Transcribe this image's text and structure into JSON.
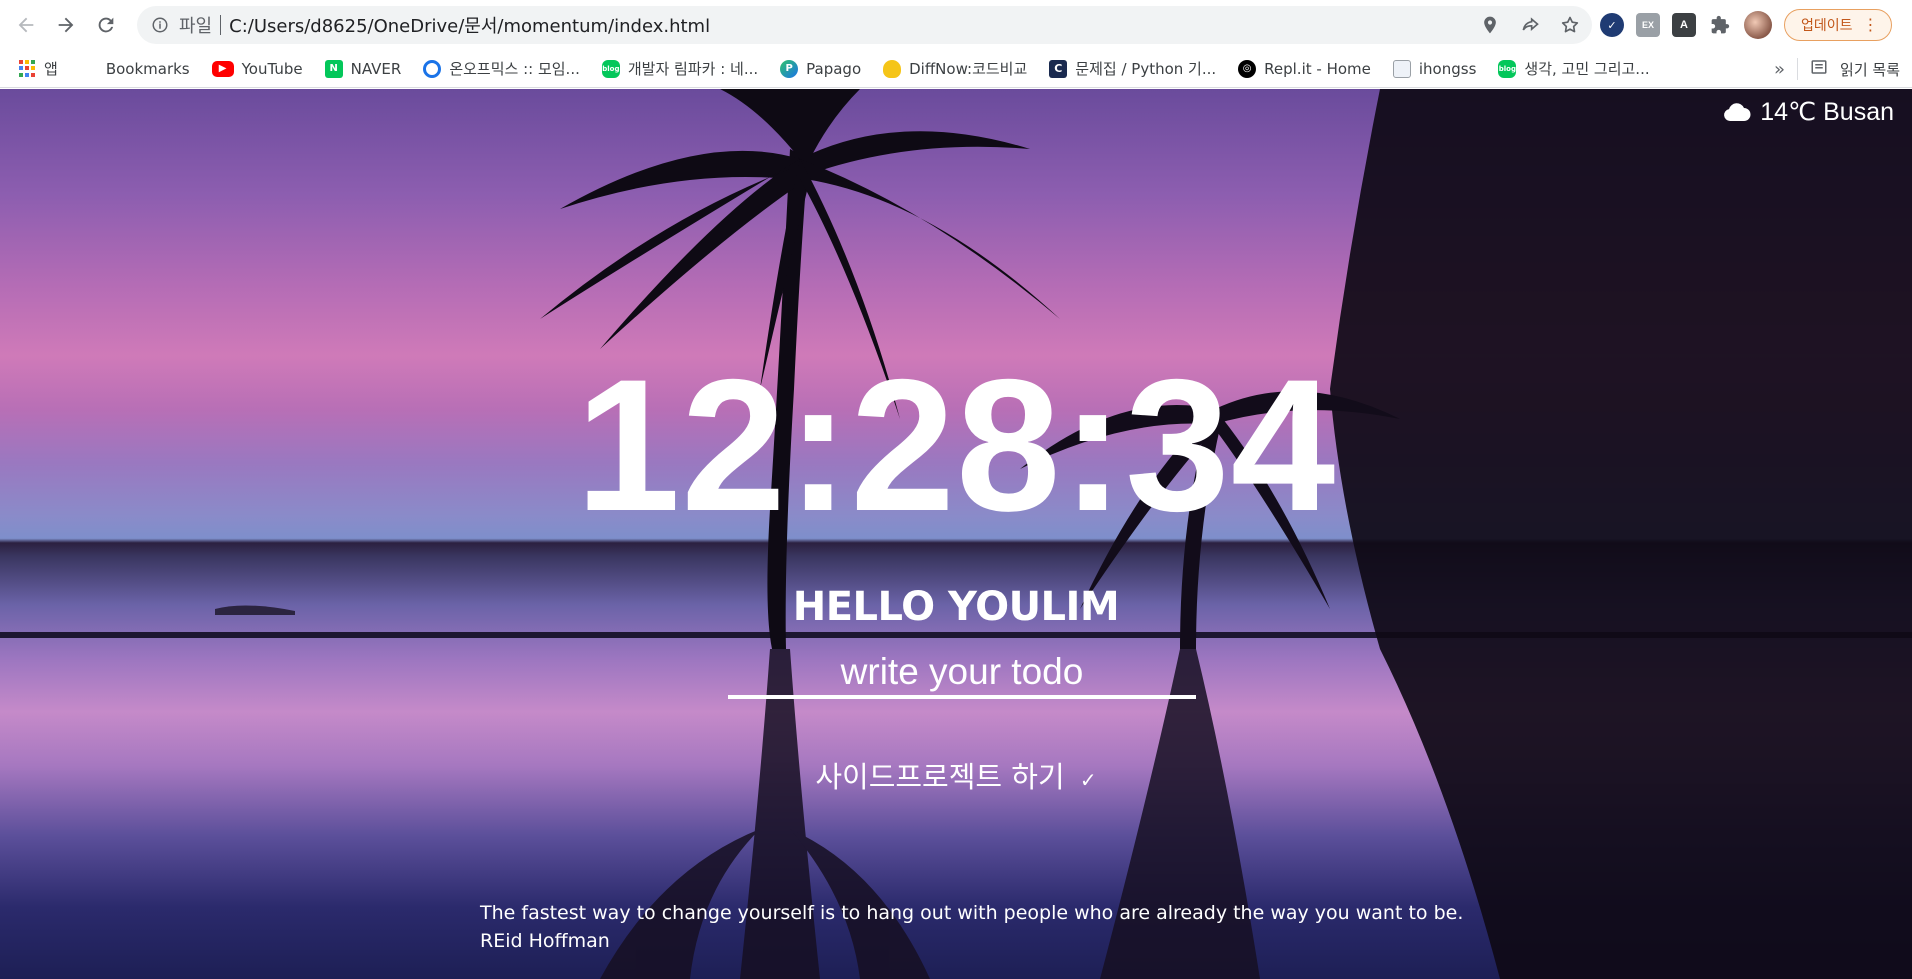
{
  "browser": {
    "scheme_label": "파일",
    "url": "C:/Users/d8625/OneDrive/문서/momentum/index.html",
    "update_label": "업데이트"
  },
  "bookmarks": {
    "items": [
      {
        "label": "앱",
        "icon": "apps-grid-icon"
      },
      {
        "label": "Bookmarks",
        "icon": "star-icon"
      },
      {
        "label": "YouTube",
        "icon": "youtube-icon"
      },
      {
        "label": "NAVER",
        "icon": "naver-icon"
      },
      {
        "label": "온오프믹스 :: 모임...",
        "icon": "onoffmix-icon"
      },
      {
        "label": "개발자 림파카 : 네...",
        "icon": "blog-icon"
      },
      {
        "label": "Papago",
        "icon": "papago-icon"
      },
      {
        "label": "DiffNow:코드비교",
        "icon": "pineapple-icon"
      },
      {
        "label": "문제집 / Python 기...",
        "icon": "codeup-icon"
      },
      {
        "label": "Repl.it - Home",
        "icon": "replit-icon"
      },
      {
        "label": "ihongss",
        "icon": "page-icon"
      },
      {
        "label": "생각, 고민 그리고...",
        "icon": "blog-icon"
      }
    ],
    "more": "»",
    "reading_list": "읽기 목록"
  },
  "app": {
    "weather": "14℃ Busan",
    "clock": "12:28:34",
    "greeting": "HELLO YOULIM",
    "todo_placeholder": "write your todo",
    "todos": [
      {
        "text": "사이드프로젝트 하기",
        "delete": "✓"
      }
    ],
    "quote": {
      "text": "The fastest way to change yourself is to hang out with people who are already the way you want to be.",
      "author": "REid Hoffman"
    }
  },
  "colors": {
    "sky_top": "#6a4b9c",
    "sky_pink": "#cf7ab8",
    "water_bottom": "#1d1f55",
    "update_accent": "#c2571a"
  }
}
